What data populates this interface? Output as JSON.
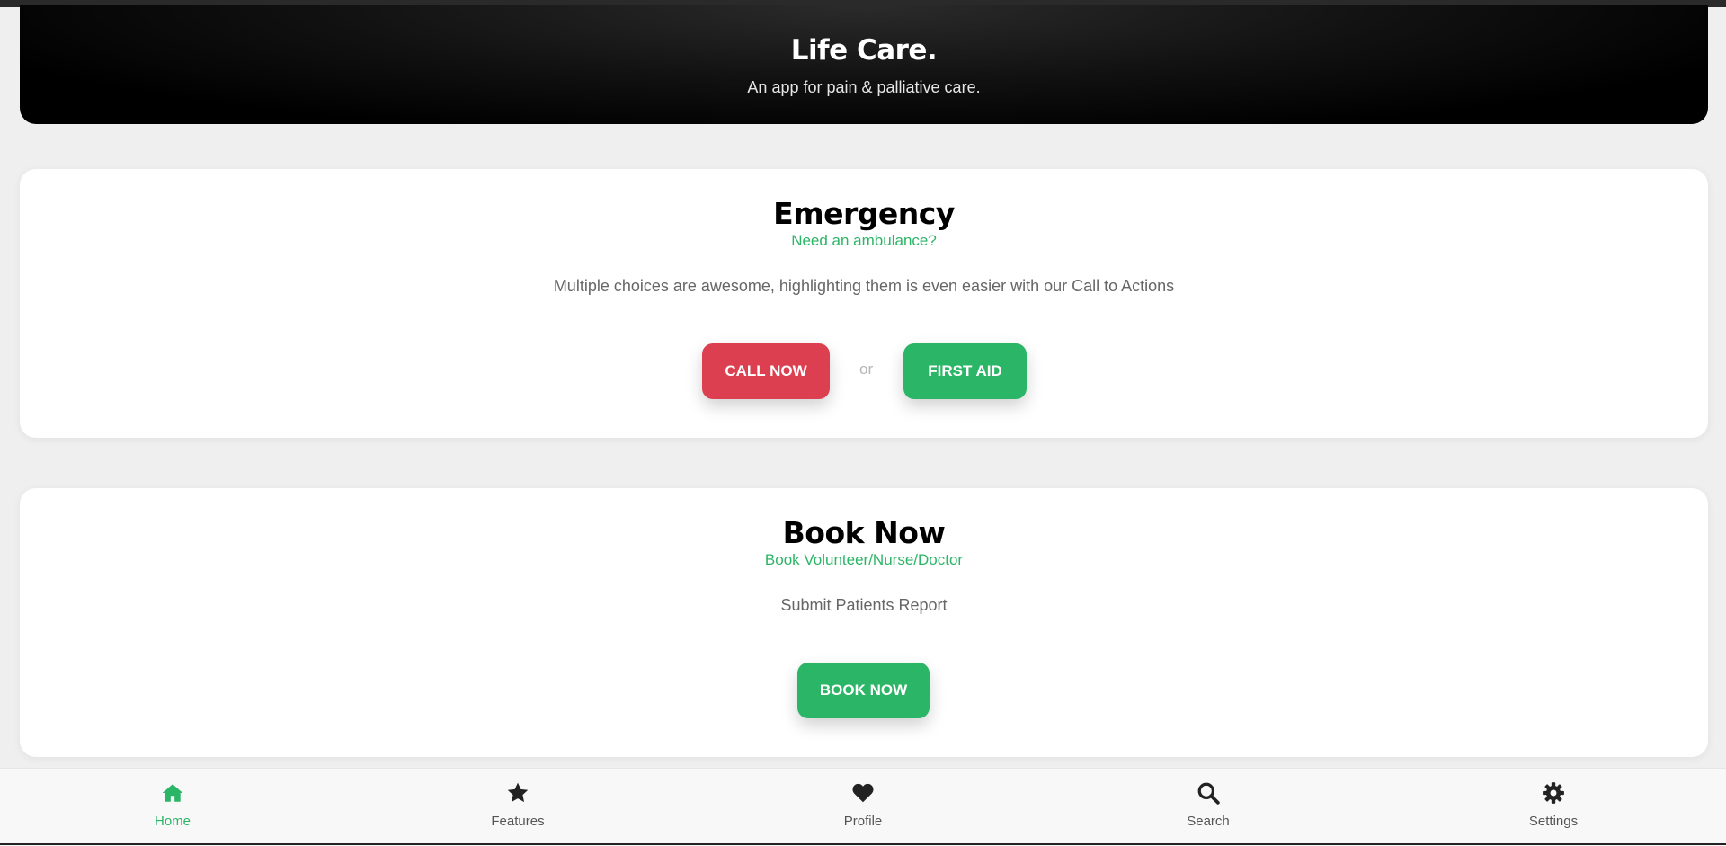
{
  "hero": {
    "title": "Life Care.",
    "subtitle": "An app for pain & palliative care."
  },
  "emergency": {
    "title": "Emergency",
    "subtitle": "Need an ambulance?",
    "description": "Multiple choices are awesome, highlighting them is even easier with our Call to Actions",
    "call_label": "CALL NOW",
    "or_label": "or",
    "first_aid_label": "FIRST AID"
  },
  "booking": {
    "title": "Book Now",
    "subtitle": "Book Volunteer/Nurse/Doctor",
    "description": "Submit Patients Report",
    "book_label": "BOOK NOW"
  },
  "nav": {
    "items": [
      {
        "label": "Home",
        "icon": "home-icon",
        "active": true
      },
      {
        "label": "Features",
        "icon": "star-icon",
        "active": false
      },
      {
        "label": "Profile",
        "icon": "heart-icon",
        "active": false
      },
      {
        "label": "Search",
        "icon": "search-icon",
        "active": false
      },
      {
        "label": "Settings",
        "icon": "gear-icon",
        "active": false
      }
    ]
  },
  "colors": {
    "accent": "#2bb566",
    "danger": "#dc3f4f"
  }
}
